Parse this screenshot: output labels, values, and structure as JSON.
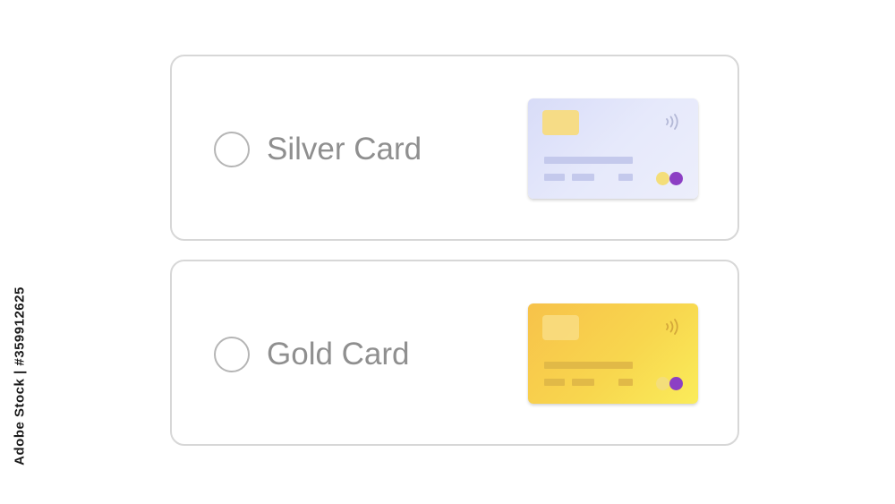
{
  "options": [
    {
      "label": "Silver Card",
      "selected": false,
      "card_style": "silver",
      "colors": {
        "card_gradient": [
          "#d8dcf8",
          "#eceefb"
        ],
        "chip": "#f6dc86",
        "bars": "#c4c9ec"
      }
    },
    {
      "label": "Gold Card",
      "selected": false,
      "card_style": "gold",
      "colors": {
        "card_gradient": [
          "#f7c24a",
          "#faec5a"
        ],
        "chip": "#f9dd84",
        "bars": "#e1b947"
      }
    }
  ],
  "card_icons": [
    "chip-icon",
    "contactless-icon",
    "card-network-logo-icon"
  ],
  "accent_colors": {
    "network_dot_left": "#f4de7a",
    "network_dot_right": "#8c3fc4",
    "border": "#d7d7d7",
    "label_text": "#8f8f8f"
  },
  "watermark": {
    "stock_id": "Adobe Stock | #359912625"
  }
}
